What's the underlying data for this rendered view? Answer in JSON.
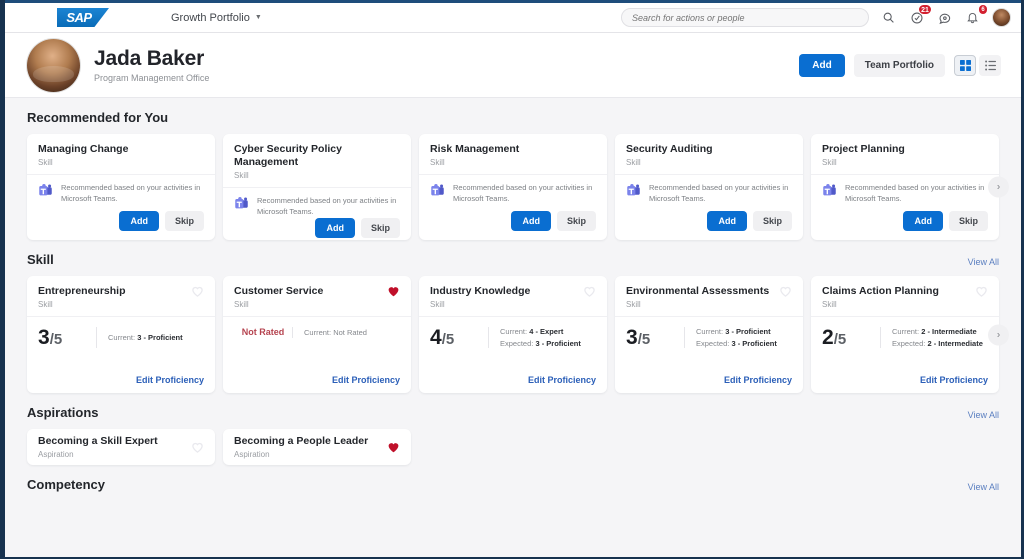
{
  "shell": {
    "logo_text": "SAP",
    "portfolio_menu": "Growth Portfolio",
    "search_placeholder": "Search for actions or people",
    "search_value": "",
    "badges": {
      "tasks": "21",
      "notifications": "6"
    }
  },
  "profile": {
    "name": "Jada Baker",
    "title": "Program Management Office",
    "add_label": "Add",
    "team_portfolio_label": "Team Portfolio"
  },
  "sections": {
    "recommended": {
      "title": "Recommended for You",
      "cards": [
        {
          "title": "Managing Change",
          "type": "Skill",
          "note": "Recommended based on your activities in Microsoft Teams.",
          "add": "Add",
          "skip": "Skip"
        },
        {
          "title": "Cyber Security Policy Management",
          "type": "Skill",
          "note": "Recommended based on your activities in Microsoft Teams.",
          "add": "Add",
          "skip": "Skip"
        },
        {
          "title": "Risk Management",
          "type": "Skill",
          "note": "Recommended based on your activities in Microsoft Teams.",
          "add": "Add",
          "skip": "Skip"
        },
        {
          "title": "Security Auditing",
          "type": "Skill",
          "note": "Recommended based on your activities in Microsoft Teams.",
          "add": "Add",
          "skip": "Skip"
        },
        {
          "title": "Project Planning",
          "type": "Skill",
          "note": "Recommended based on your activities in Microsoft Teams.",
          "add": "Add",
          "skip": "Skip"
        }
      ]
    },
    "skill": {
      "title": "Skill",
      "view_all": "View All",
      "edit_label": "Edit Proficiency",
      "current_label": "Current:",
      "expected_label": "Expected:",
      "cards": [
        {
          "title": "Entrepreneurship",
          "type": "Skill",
          "score": "3",
          "denom": "/5",
          "rated": true,
          "favorite": false,
          "current": "3 - Proficient",
          "expected": ""
        },
        {
          "title": "Customer Service",
          "type": "Skill",
          "score": "",
          "denom": "",
          "rated": false,
          "not_rated_label": "Not Rated",
          "favorite": true,
          "current": "Not Rated",
          "expected": ""
        },
        {
          "title": "Industry Knowledge",
          "type": "Skill",
          "score": "4",
          "denom": "/5",
          "rated": true,
          "favorite": false,
          "current": "4 - Expert",
          "expected": "3 - Proficient"
        },
        {
          "title": "Environmental Assessments",
          "type": "Skill",
          "score": "3",
          "denom": "/5",
          "rated": true,
          "favorite": false,
          "current": "3 - Proficient",
          "expected": "3 - Proficient"
        },
        {
          "title": "Claims Action Planning",
          "type": "Skill",
          "score": "2",
          "denom": "/5",
          "rated": true,
          "favorite": false,
          "current": "2 - Intermediate",
          "expected": "2 - Intermediate"
        }
      ]
    },
    "aspirations": {
      "title": "Aspirations",
      "view_all": "View All",
      "cards": [
        {
          "title": "Becoming a Skill Expert",
          "type": "Aspiration",
          "favorite": false
        },
        {
          "title": "Becoming a People Leader",
          "type": "Aspiration",
          "favorite": true
        }
      ]
    },
    "competency": {
      "title": "Competency",
      "view_all": "View All"
    }
  },
  "colors": {
    "accent": "#0a6ed1",
    "link": "#2b5fb8",
    "favorite": "#c0102a",
    "badge": "#d32030"
  }
}
